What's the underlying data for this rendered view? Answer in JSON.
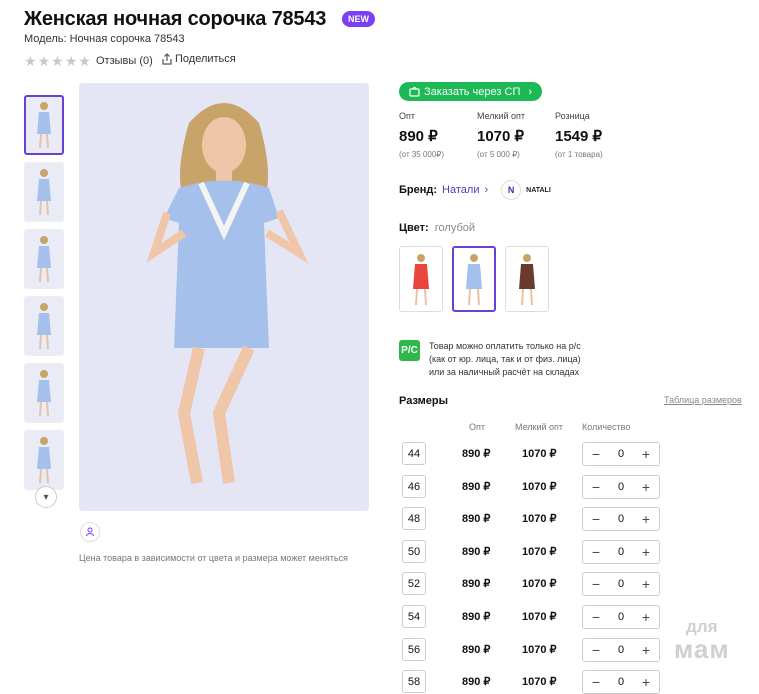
{
  "product": {
    "title": "Женская ночная сорочка 78543",
    "new_badge": "NEW",
    "model": "Модель: Ночная сорочка 78543",
    "reviews": "Отзывы (0)",
    "share": "Поделиться",
    "price_note": "Цена товара в зависимости от цвета и размера может меняться"
  },
  "order_button": {
    "label": "Заказать через СП"
  },
  "prices": [
    {
      "label": "Опт",
      "value": "890 ₽",
      "note": "(от 35 000₽)"
    },
    {
      "label": "Мелкий опт",
      "value": "1070 ₽",
      "note": "(от 5 000 ₽)"
    },
    {
      "label": "Розница",
      "value": "1549 ₽",
      "note": "(от 1 товара)"
    }
  ],
  "brand": {
    "label": "Бренд:",
    "name": "Натали",
    "logo_text": "NATALI"
  },
  "color": {
    "label": "Цвет:",
    "value": "голубой",
    "swatches": [
      "#e8453c",
      "#a6c0ec",
      "#6b3a2e"
    ],
    "selected_index": 1
  },
  "payment": {
    "lines": [
      "Товар можно оплатить только на р/с",
      "(как от юр. лица, так и от физ. лица)",
      "или за наличный расчёт на складах"
    ]
  },
  "sizes": {
    "title": "Размеры",
    "table_link": "Таблица размеров",
    "headers": {
      "opt": "Опт",
      "small_opt": "Мелкий опт",
      "qty": "Количество"
    },
    "rows": [
      {
        "size": "44",
        "opt": "890 ₽",
        "small_opt": "1070 ₽",
        "qty": "0"
      },
      {
        "size": "46",
        "opt": "890 ₽",
        "small_opt": "1070 ₽",
        "qty": "0"
      },
      {
        "size": "48",
        "opt": "890 ₽",
        "small_opt": "1070 ₽",
        "qty": "0"
      },
      {
        "size": "50",
        "opt": "890 ₽",
        "small_opt": "1070 ₽",
        "qty": "0"
      },
      {
        "size": "52",
        "opt": "890 ₽",
        "small_opt": "1070 ₽",
        "qty": "0"
      },
      {
        "size": "54",
        "opt": "890 ₽",
        "small_opt": "1070 ₽",
        "qty": "0"
      },
      {
        "size": "56",
        "opt": "890 ₽",
        "small_opt": "1070 ₽",
        "qty": "0"
      },
      {
        "size": "58",
        "opt": "890 ₽",
        "small_opt": "1070 ₽",
        "qty": "0"
      }
    ]
  },
  "watermark": {
    "line1": "для",
    "line2": "мам"
  },
  "colors": {
    "accent": "#7b3ff2",
    "order_green": "#1db954",
    "dress_blue": "#a6c0ec"
  }
}
